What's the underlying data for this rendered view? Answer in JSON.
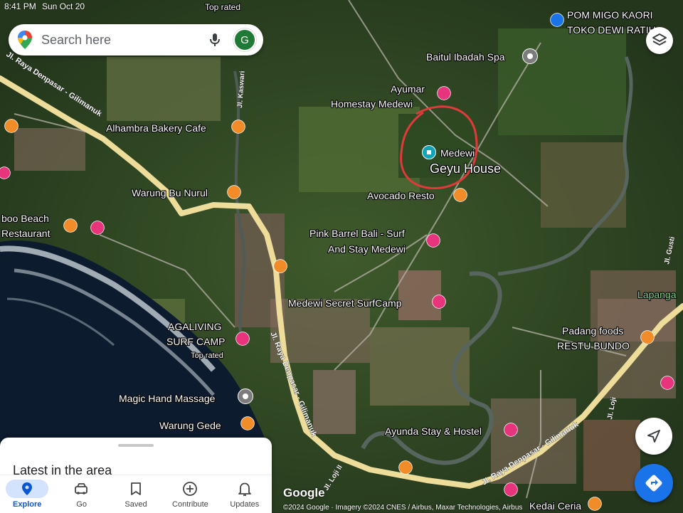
{
  "status_bar": {
    "time": "8:41 PM",
    "date": "Sun Oct 20"
  },
  "search": {
    "placeholder": "Search here",
    "avatar_letter": "G"
  },
  "map": {
    "top_rated_label": "Top rated",
    "places": [
      {
        "name": "POM MIGO KAORI",
        "type": "shop",
        "color": "#1a73e8"
      },
      {
        "name": "TOKO DEWI RATIH",
        "type": "shop",
        "color": "#1a73e8"
      },
      {
        "name": "Baitul Ibadah Spa",
        "type": "spa",
        "color": "#7c7c7c"
      },
      {
        "name": "Ayumar",
        "type": "hotel",
        "color": "#e8337d"
      },
      {
        "name": "Homestay Medewi",
        "type": "hotel",
        "color": "#e8337d"
      },
      {
        "name": "Alhambra Bakery Cafe",
        "type": "cafe",
        "color": "#f28c28"
      },
      {
        "name": "Medewi",
        "type": "selected",
        "color": "#12a3b8"
      },
      {
        "name": "Geyu House",
        "type": "label",
        "color": "#ffffff"
      },
      {
        "name": "Warung Bu Nurul",
        "type": "food",
        "color": "#f28c28"
      },
      {
        "name": "Avocado Resto",
        "type": "food",
        "color": "#f28c28"
      },
      {
        "name": "boo Beach",
        "type": "food",
        "color": "#f28c28"
      },
      {
        "name": "Restaurant",
        "type": "food",
        "color": "#f28c28"
      },
      {
        "name": "Pink Barrel Bali - Surf",
        "type": "hotel",
        "color": "#e8337d"
      },
      {
        "name": "And Stay Medewi",
        "type": "hotel",
        "color": "#e8337d"
      },
      {
        "name": "Medewi Secret SurfCamp",
        "type": "hotel",
        "color": "#e8337d"
      },
      {
        "name": "AGALIVING",
        "type": "hotel",
        "color": "#e8337d"
      },
      {
        "name": "SURF CAMP",
        "type": "hotel",
        "color": "#e8337d"
      },
      {
        "name": "Padang foods",
        "type": "food",
        "color": "#f28c28"
      },
      {
        "name": "RESTU BUNDO",
        "type": "food",
        "color": "#f28c28"
      },
      {
        "name": "Magic Hand Massage",
        "type": "spa",
        "color": "#7c7c7c"
      },
      {
        "name": "Warung Gede",
        "type": "food",
        "color": "#f28c28"
      },
      {
        "name": "Ayunda Stay & Hostel",
        "type": "hotel",
        "color": "#e8337d"
      },
      {
        "name": "Kedai Ceria",
        "type": "food",
        "color": "#f28c28"
      },
      {
        "name": "Lapanga",
        "type": "park",
        "color": "#34a853"
      }
    ],
    "roads": [
      "Jl. Raya Denpasar - Gilimanuk",
      "Jl. Raya Denpasar - Gilimanuk",
      "Jl. Raya Denpasar - Gilimanuk",
      "Jl. Kaswari",
      "Jl. Loji II",
      "Jl. Loji",
      "Jl. Gusti"
    ]
  },
  "sheet": {
    "title": "Latest in the area"
  },
  "nav": [
    {
      "label": "Explore",
      "icon": "explore-pin-icon",
      "active": true
    },
    {
      "label": "Go",
      "icon": "car-icon",
      "active": false
    },
    {
      "label": "Saved",
      "icon": "bookmark-icon",
      "active": false
    },
    {
      "label": "Contribute",
      "icon": "plus-circle-icon",
      "active": false
    },
    {
      "label": "Updates",
      "icon": "bell-icon",
      "active": false
    }
  ],
  "attribution": {
    "logo": "Google",
    "copyright": "©2024 Google · Imagery ©2024 CNES / Airbus, Maxar Technologies, Airbus"
  },
  "colors": {
    "accent": "#1a73e8",
    "road": "#eedd9a",
    "annotation_circle": "#e03a3a"
  }
}
